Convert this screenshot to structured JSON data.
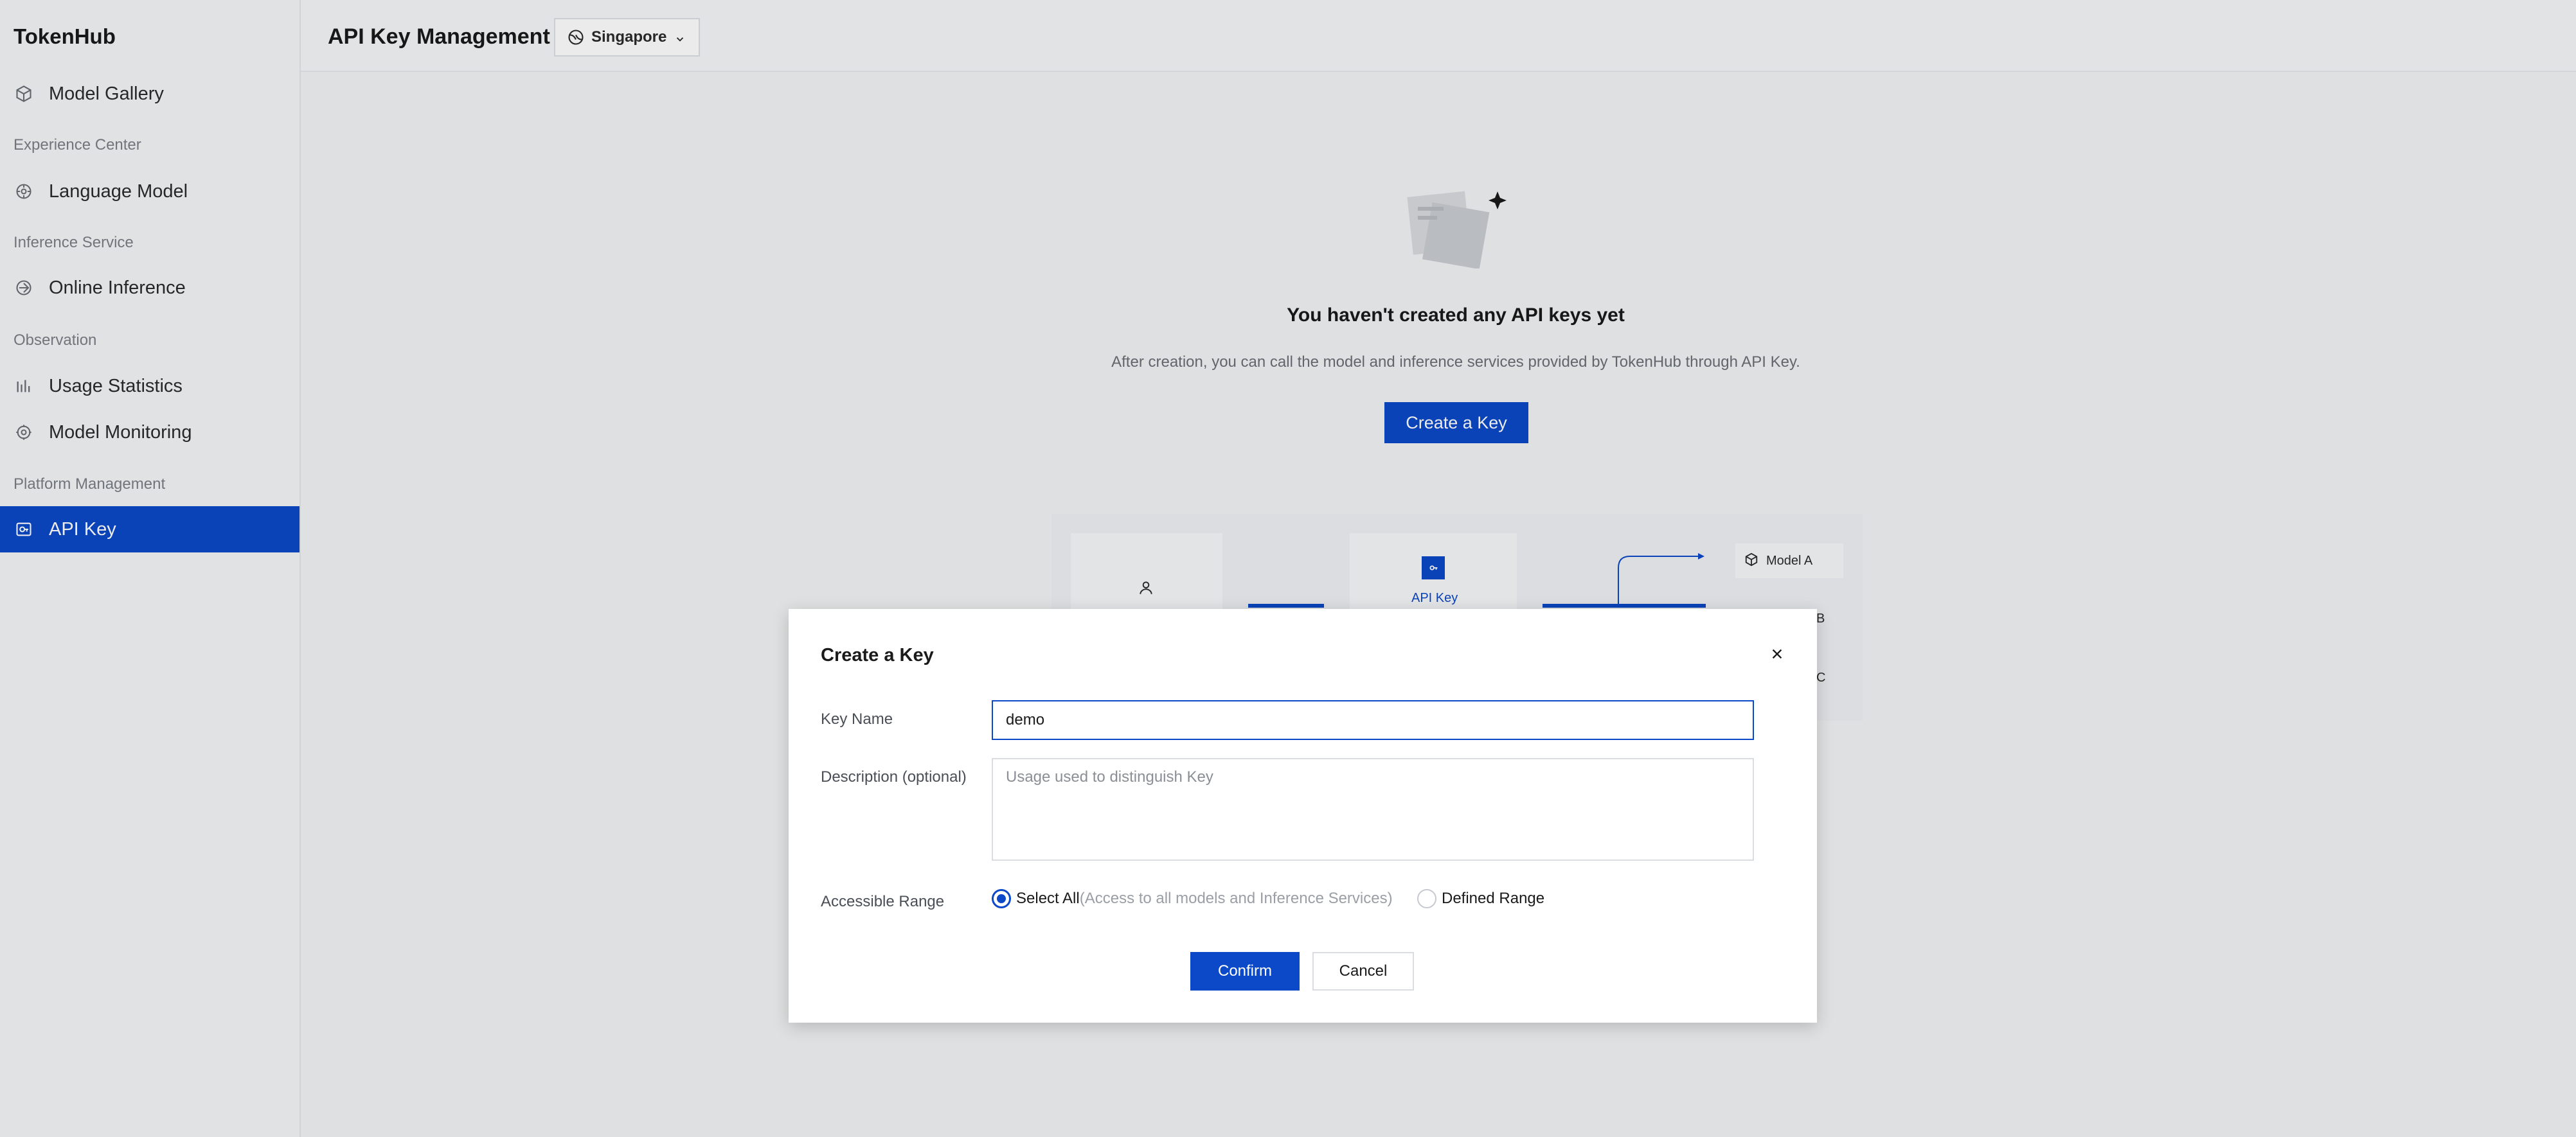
{
  "app": {
    "brand": "TokenHub"
  },
  "sidebar": {
    "items": [
      {
        "label": "Model Gallery",
        "icon": "cube-icon"
      },
      {
        "label": "Language Model",
        "icon": "model-icon"
      },
      {
        "label": "Online Inference",
        "icon": "inference-icon"
      },
      {
        "label": "Usage Statistics",
        "icon": "bar-chart-icon"
      },
      {
        "label": "Model Monitoring",
        "icon": "monitor-icon"
      },
      {
        "label": "API Key",
        "icon": "key-icon"
      }
    ],
    "sections": [
      "Experience Center",
      "Inference Service",
      "Observation",
      "Platform Management"
    ],
    "active": "API Key"
  },
  "header": {
    "title": "API Key Management",
    "region": "Singapore"
  },
  "empty_state": {
    "title": "You haven't created any API keys yet",
    "description": "After creation, you can call the model and inference services provided by TokenHub through API Key.",
    "button": "Create a Key"
  },
  "diagram": {
    "api_key_label": "API Key",
    "model_a": "Model A",
    "model_b_partial": "B",
    "model_c_partial": "C"
  },
  "modal": {
    "title": "Create a Key",
    "key_name_label": "Key Name",
    "key_name_value": "demo",
    "description_label": "Description (optional)",
    "description_placeholder": "Usage used to distinguish Key",
    "range_label": "Accessible Range",
    "option_all": "Select All",
    "option_all_hint": "(Access to all models and Inference Services)",
    "option_defined": "Defined Range",
    "confirm": "Confirm",
    "cancel": "Cancel"
  },
  "colors": {
    "accent": "#0b49c8",
    "sidebar_bg": "#f5f6f8",
    "page_bg": "#f2f3f5"
  }
}
